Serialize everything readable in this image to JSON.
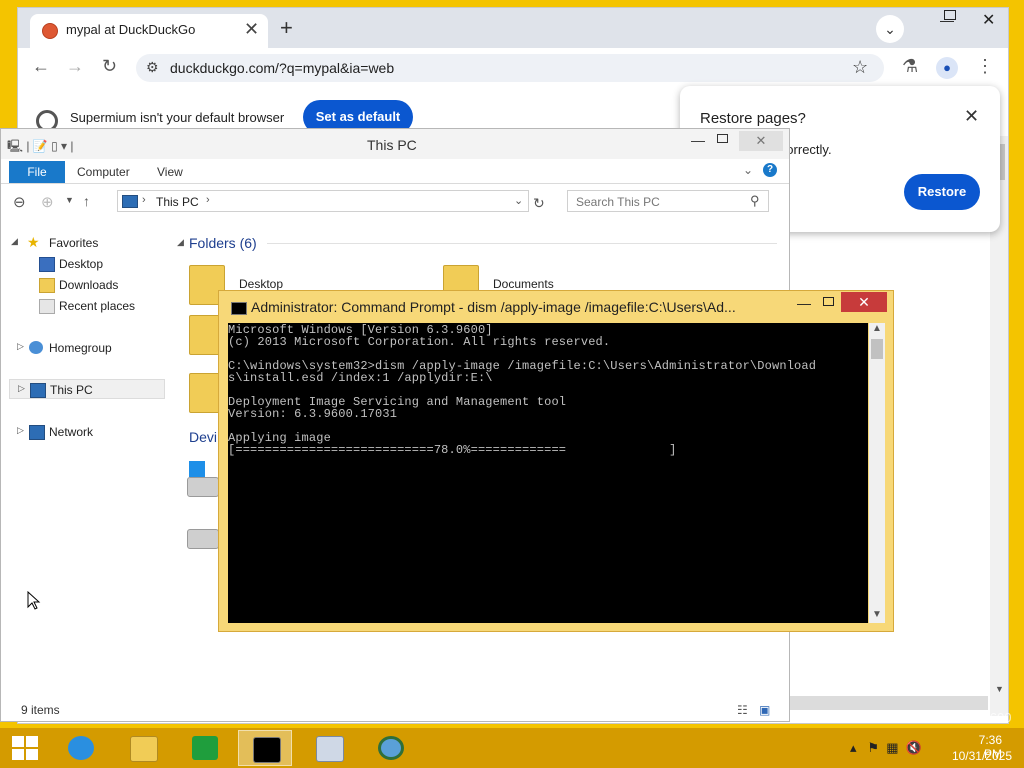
{
  "chrome": {
    "tab_title": "mypal at DuckDuckGo",
    "tab_close": "✕",
    "new_tab": "+",
    "url": "duckduckgo.com/?q=mypal&ia=web",
    "infobar_text": "Supermium isn't your default browser",
    "set_default_label": "Set as default",
    "restore": {
      "title": "Restore pages?",
      "message": "n't shut down correctly.",
      "button": "Restore",
      "close": "✕"
    }
  },
  "explorer": {
    "title": "This PC",
    "ribbon": {
      "file": "File",
      "tabs": [
        "Computer",
        "View"
      ],
      "help": "?"
    },
    "address": "This PC",
    "search_placeholder": "Search This PC",
    "nav": {
      "favorites": "Favorites",
      "desktop": "Desktop",
      "downloads": "Downloads",
      "recent": "Recent places",
      "homegroup": "Homegroup",
      "thispc": "This PC",
      "network": "Network"
    },
    "folders_header": "Folders (6)",
    "folders": [
      "Desktop",
      "Documents"
    ],
    "devices_header": "Devi",
    "status": "9 items"
  },
  "cmd": {
    "title": "Administrator: Command Prompt - dism  /apply-image /imagefile:C:\\Users\\Ad...",
    "lines": [
      "Microsoft Windows [Version 6.3.9600]",
      "(c) 2013 Microsoft Corporation. All rights reserved.",
      "",
      "C:\\windows\\system32>dism /apply-image /imagefile:C:\\Users\\Administrator\\Download",
      "s\\install.esd /index:1 /applydir:E:\\",
      "",
      "Deployment Image Servicing and Management tool",
      "Version: 6.3.9600.17031",
      "",
      "Applying image",
      "[===========================78.0%=============              ]"
    ],
    "progress_percent": 78.0
  },
  "taskbar": {
    "time": "7:36 PM",
    "date": "10/31/2025",
    "apps": [
      "internet-explorer",
      "file-explorer",
      "store",
      "command-prompt",
      "performance-monitor",
      "chrome"
    ]
  },
  "watermark": "Build 9600"
}
